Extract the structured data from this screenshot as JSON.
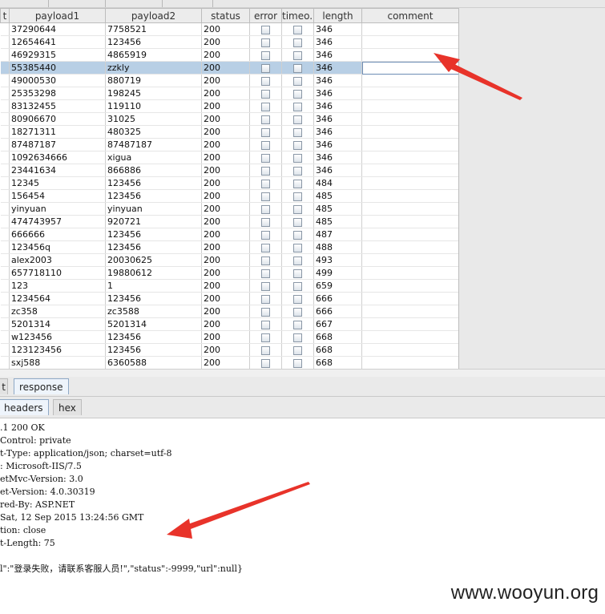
{
  "table": {
    "columns": [
      "t",
      "payload1",
      "payload2",
      "status",
      "error",
      "timeo...",
      "length",
      "comment"
    ],
    "rows": [
      {
        "payload1": "37290644",
        "payload2": "7758521",
        "status": "200",
        "length": "346"
      },
      {
        "payload1": "12654641",
        "payload2": "123456",
        "status": "200",
        "length": "346"
      },
      {
        "payload1": "46929315",
        "payload2": "4865919",
        "status": "200",
        "length": "346"
      },
      {
        "payload1": "55385440",
        "payload2": "zzkly",
        "status": "200",
        "length": "346",
        "selected": true
      },
      {
        "payload1": "49000530",
        "payload2": "880719",
        "status": "200",
        "length": "346"
      },
      {
        "payload1": "25353298",
        "payload2": "198245",
        "status": "200",
        "length": "346"
      },
      {
        "payload1": "83132455",
        "payload2": "119110",
        "status": "200",
        "length": "346"
      },
      {
        "payload1": "80906670",
        "payload2": "31025",
        "status": "200",
        "length": "346"
      },
      {
        "payload1": "18271311",
        "payload2": "480325",
        "status": "200",
        "length": "346"
      },
      {
        "payload1": "87487187",
        "payload2": "87487187",
        "status": "200",
        "length": "346"
      },
      {
        "payload1": "1092634666",
        "payload2": "xigua",
        "status": "200",
        "length": "346"
      },
      {
        "payload1": "23441634",
        "payload2": "866886",
        "status": "200",
        "length": "346"
      },
      {
        "payload1": "12345",
        "payload2": "123456",
        "status": "200",
        "length": "484"
      },
      {
        "payload1": "156454",
        "payload2": "123456",
        "status": "200",
        "length": "485"
      },
      {
        "payload1": "yinyuan",
        "payload2": "yinyuan",
        "status": "200",
        "length": "485"
      },
      {
        "payload1": "474743957",
        "payload2": "920721",
        "status": "200",
        "length": "485"
      },
      {
        "payload1": "666666",
        "payload2": "123456",
        "status": "200",
        "length": "487"
      },
      {
        "payload1": "123456q",
        "payload2": "123456",
        "status": "200",
        "length": "488"
      },
      {
        "payload1": "alex2003",
        "payload2": "20030625",
        "status": "200",
        "length": "493"
      },
      {
        "payload1": "657718110",
        "payload2": "19880612",
        "status": "200",
        "length": "499"
      },
      {
        "payload1": "123",
        "payload2": "1",
        "status": "200",
        "length": "659"
      },
      {
        "payload1": "1234564",
        "payload2": "123456",
        "status": "200",
        "length": "666"
      },
      {
        "payload1": "zc358",
        "payload2": "zc3588",
        "status": "200",
        "length": "666"
      },
      {
        "payload1": "5201314",
        "payload2": "5201314",
        "status": "200",
        "length": "667"
      },
      {
        "payload1": "w123456",
        "payload2": "123456",
        "status": "200",
        "length": "668"
      },
      {
        "payload1": "123123456",
        "payload2": "123456",
        "status": "200",
        "length": "668"
      },
      {
        "payload1": "sxj588",
        "payload2": "6360588",
        "status": "200",
        "length": "668"
      }
    ]
  },
  "tabs_top": {
    "request_label": "t",
    "response_label": "response"
  },
  "tabs_sub": {
    "headers_label": "headers",
    "hex_label": "hex"
  },
  "response_lines": [
    ".1 200 OK",
    "Control: private",
    "t-Type: application/json; charset=utf-8",
    ": Microsoft-IIS/7.5",
    "etMvc-Version: 3.0",
    "et-Version: 4.0.30319",
    "red-By: ASP.NET",
    "Sat, 12 Sep 2015 13:24:56 GMT",
    "tion: close",
    "t-Length: 75",
    "",
    "l\":\"登录失败，请联系客服人员!\",\"status\":-9999,\"url\":null}"
  ],
  "watermark": "www.wooyun.org",
  "colors": {
    "selection": "#b8cfe5",
    "arrow": "#e8332a",
    "active_tab": "#eef4fb"
  }
}
